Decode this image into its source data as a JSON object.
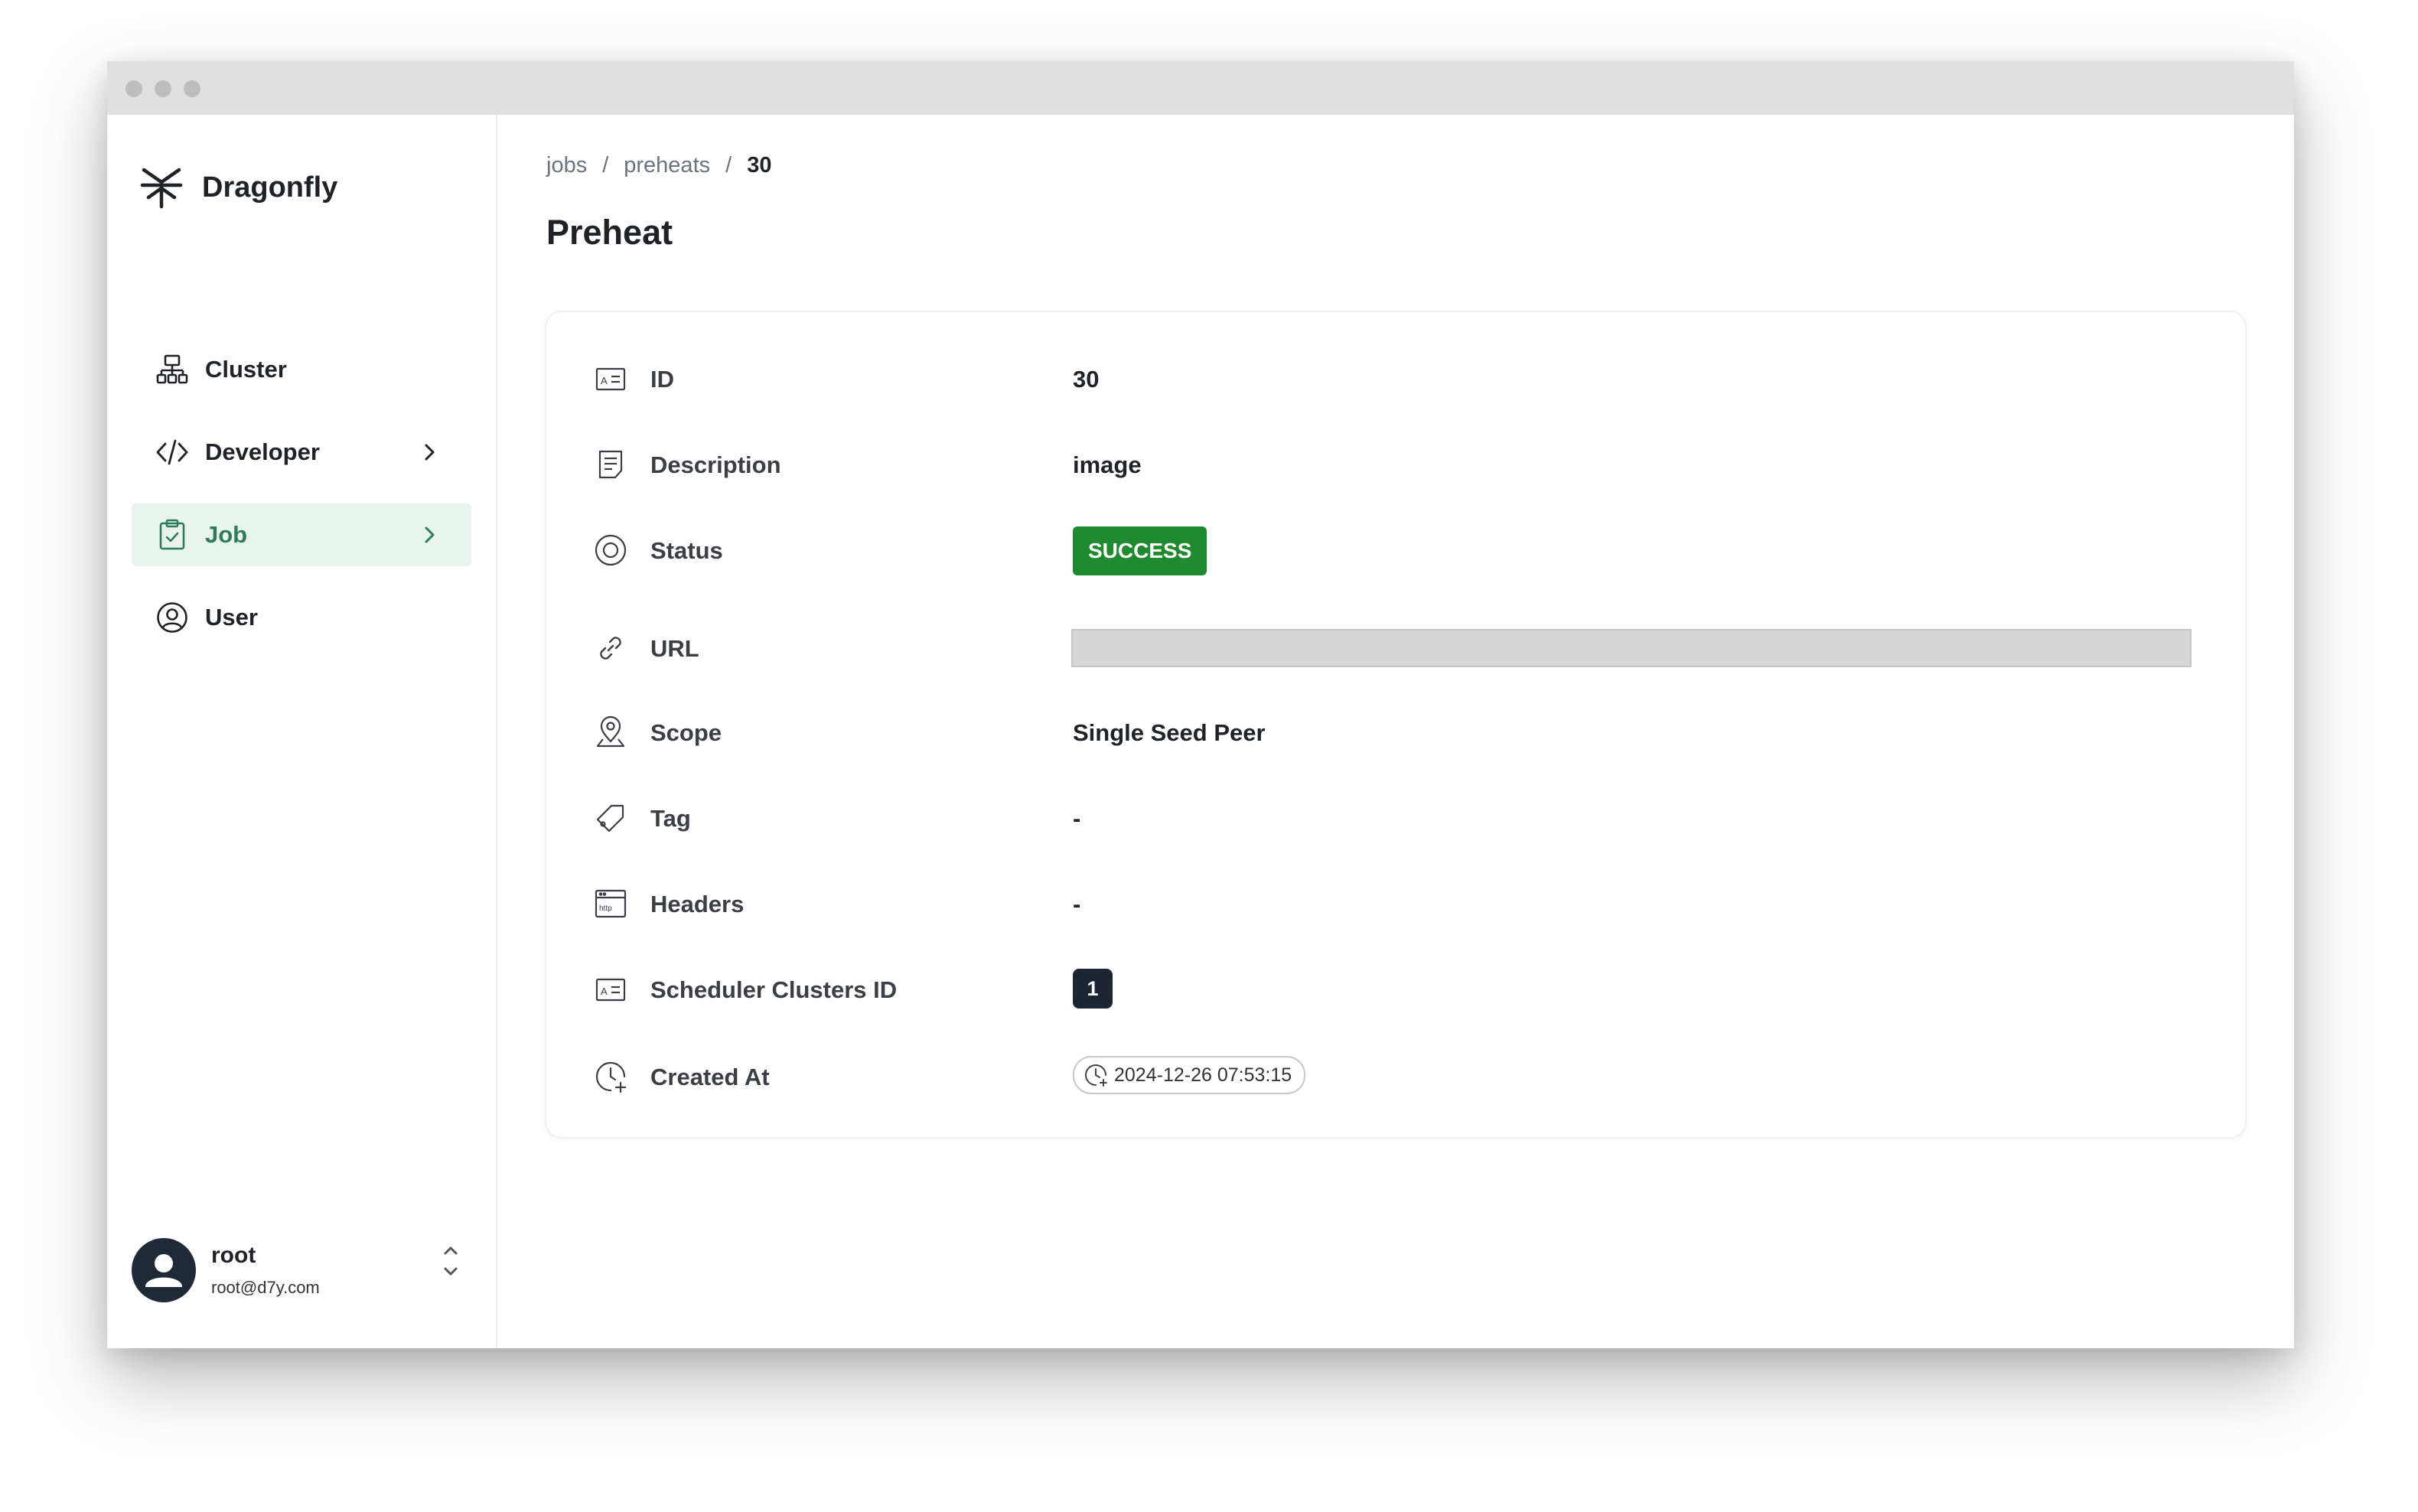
{
  "app": {
    "name": "Dragonfly"
  },
  "sidebar": {
    "items": [
      {
        "label": "Cluster",
        "icon": "cluster-icon",
        "active": false,
        "expandable": false
      },
      {
        "label": "Developer",
        "icon": "code-icon",
        "active": false,
        "expandable": true
      },
      {
        "label": "Job",
        "icon": "clipboard-check-icon",
        "active": true,
        "expandable": true
      },
      {
        "label": "User",
        "icon": "user-circle-icon",
        "active": false,
        "expandable": false
      }
    ]
  },
  "user": {
    "name": "root",
    "email": "root@d7y.com"
  },
  "breadcrumb": {
    "items": [
      "jobs",
      "preheats"
    ],
    "current": "30",
    "separator": "/"
  },
  "page": {
    "title": "Preheat"
  },
  "details": {
    "id": {
      "label": "ID",
      "value": "30"
    },
    "description": {
      "label": "Description",
      "value": "image"
    },
    "status": {
      "label": "Status",
      "value": "SUCCESS"
    },
    "url": {
      "label": "URL"
    },
    "scope": {
      "label": "Scope",
      "value": "Single Seed Peer"
    },
    "tag": {
      "label": "Tag",
      "value": "-"
    },
    "headers": {
      "label": "Headers",
      "value": "-"
    },
    "scheduler_clusters": {
      "label": "Scheduler Clusters ID",
      "value": "1"
    },
    "created_at": {
      "label": "Created At",
      "value": "2024-12-26 07:53:15"
    }
  },
  "colors": {
    "accent": "#2e7d5a",
    "active_bg": "#eaf4ee",
    "success": "#1f8a2f",
    "chip_dark": "#1c2633"
  }
}
